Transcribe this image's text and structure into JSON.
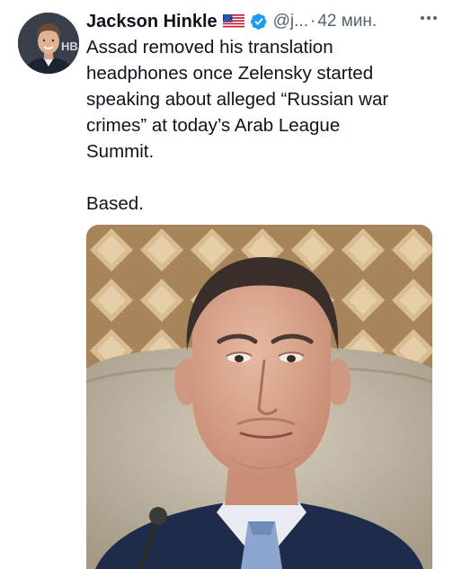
{
  "tweet": {
    "author": {
      "display_name": "Jackson Hinkle",
      "flag": "us-flag-icon",
      "verified": "verified-badge-icon",
      "handle": "@j...",
      "separator": "·",
      "time": "42 мин.",
      "avatar_text": "HB"
    },
    "text_lines": [
      "Assad removed his translation",
      "headphones once Zelensky started",
      "speaking about alleged “Russian war",
      "crimes” at today’s Arab League",
      "Summit."
    ],
    "text_line_2": "Based.",
    "more_menu": "more-options-icon"
  },
  "colors": {
    "text_primary": "#0f1419",
    "text_secondary": "#536471",
    "verified_blue": "#1d9bf0",
    "background": "#ffffff"
  }
}
